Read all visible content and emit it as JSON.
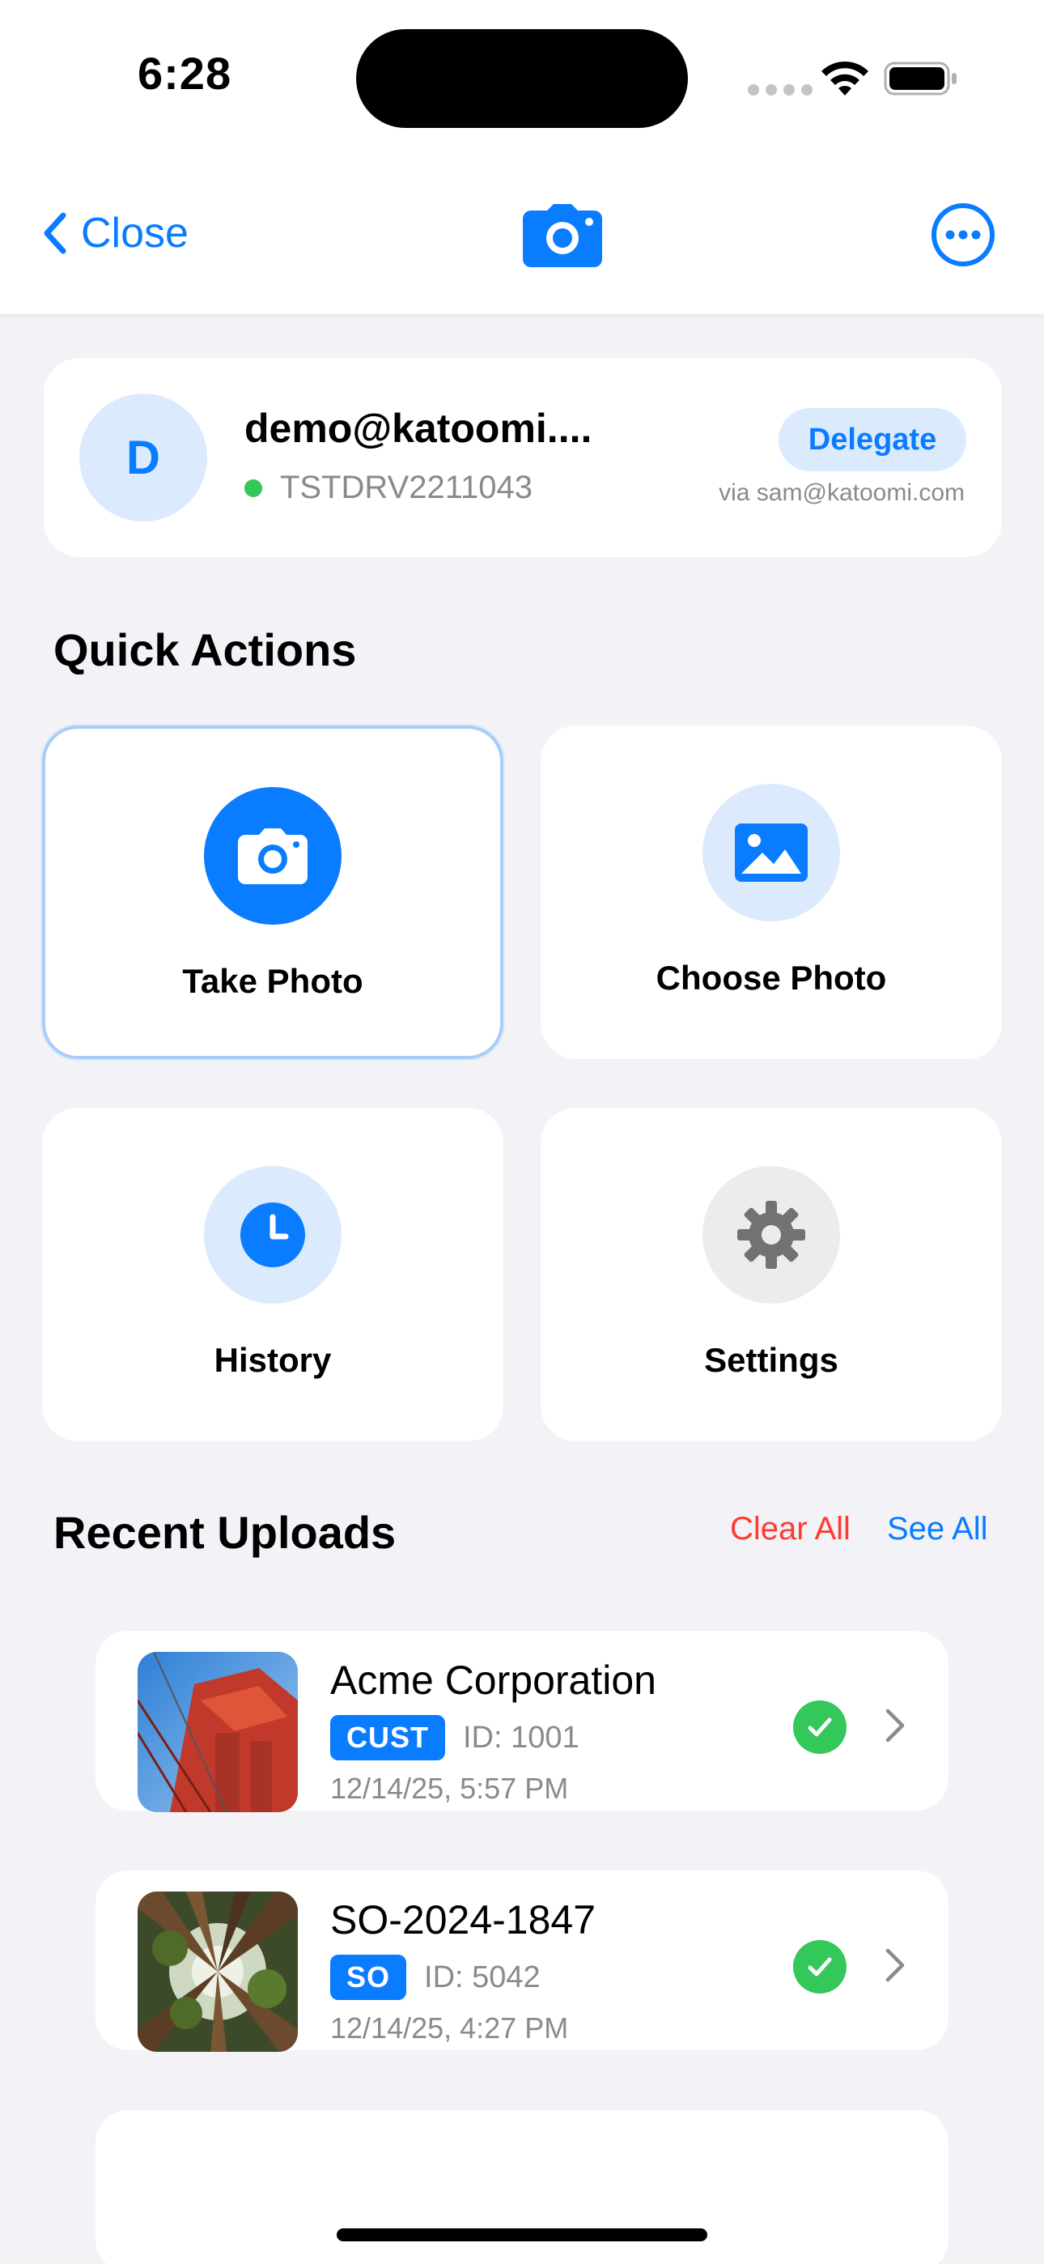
{
  "status_bar": {
    "time": "6:28"
  },
  "nav": {
    "back_label": "Close",
    "center_icon": "camera-icon",
    "right_icon": "more-icon"
  },
  "account": {
    "avatar_initial": "D",
    "email": "demo@katoomi....",
    "device_id": "TSTDRV2211043",
    "status": "online",
    "delegate_label": "Delegate",
    "via_text": "via sam@katoomi.com"
  },
  "quick_actions": {
    "title": "Quick Actions",
    "items": [
      {
        "label": "Take Photo",
        "icon": "camera-icon",
        "selected": true
      },
      {
        "label": "Choose Photo",
        "icon": "photo-icon",
        "selected": false
      },
      {
        "label": "History",
        "icon": "clock-icon",
        "selected": false
      },
      {
        "label": "Settings",
        "icon": "gear-icon",
        "selected": false
      }
    ]
  },
  "recent_uploads": {
    "title": "Recent Uploads",
    "clear_all_label": "Clear All",
    "see_all_label": "See All",
    "items": [
      {
        "title": "Acme Corporation",
        "tag": "CUST",
        "id_text": "ID: 1001",
        "date": "12/14/25, 5:57 PM",
        "status": "uploaded"
      },
      {
        "title": "SO-2024-1847",
        "tag": "SO",
        "id_text": "ID: 5042",
        "date": "12/14/25, 4:27 PM",
        "status": "uploaded"
      }
    ]
  },
  "colors": {
    "accent": "#0a7cff",
    "accent_light": "#dbeafc",
    "success": "#34c759",
    "destructive": "#ff3b30",
    "background": "#f2f2f7",
    "secondary_text": "#8a8a8e"
  }
}
